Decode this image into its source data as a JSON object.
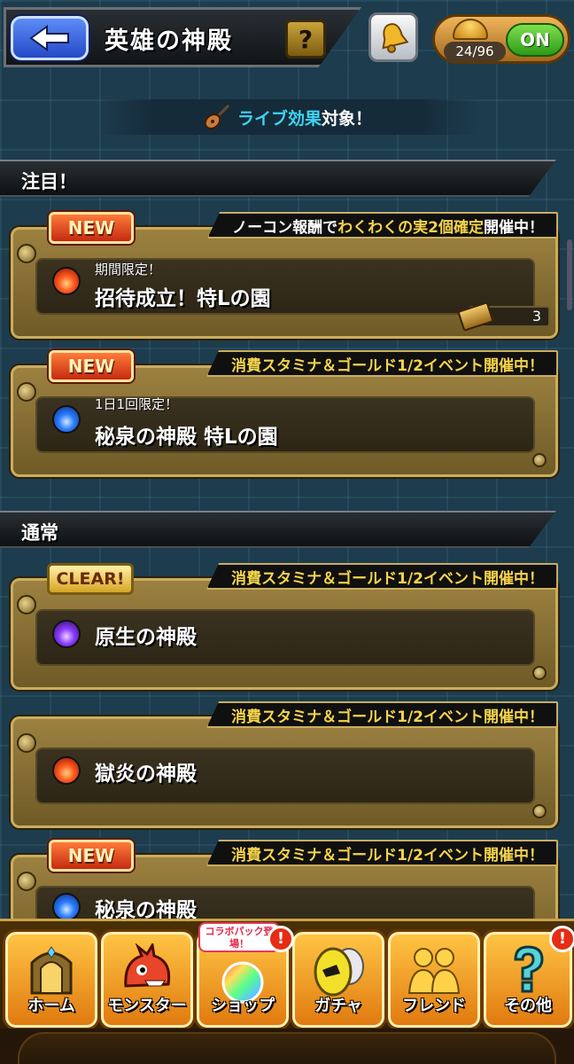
{
  "header": {
    "title": "英雄の神殿",
    "help_label": "?",
    "stamina_count": "24/96",
    "toggle_label": "ON"
  },
  "live_banner": {
    "accent": "ライブ効果",
    "rest": "対象！"
  },
  "sections": [
    {
      "title": "注目！"
    },
    {
      "title": "通常"
    }
  ],
  "cards": [
    {
      "badge": "NEW",
      "event_parts": [
        "ノーコン報酬で",
        "わくわくの実2個確定",
        "開催中！"
      ],
      "element": "fire",
      "sub": "期間限定！",
      "name": "招待成立！特Lの園",
      "ticket_count": "3"
    },
    {
      "badge": "NEW",
      "event_parts": [
        "消費スタミナ＆ゴールド1/2イベント開催中！"
      ],
      "element": "water",
      "sub": "1日1回限定！",
      "name": "秘泉の神殿 特Lの園"
    },
    {
      "badge": "CLEAR!",
      "event_parts": [
        "消費スタミナ＆ゴールド1/2イベント開催中！"
      ],
      "element": "dark",
      "name": "原生の神殿"
    },
    {
      "badge": "",
      "event_parts": [
        "消費スタミナ＆ゴールド1/2イベント開催中！"
      ],
      "element": "fire",
      "name": "獄炎の神殿"
    },
    {
      "badge": "NEW",
      "event_parts": [
        "消費スタミナ＆ゴールド1/2イベント開催中！"
      ],
      "element": "water",
      "name": "秘泉の神殿"
    }
  ],
  "bottom_nav": {
    "collab_tag": "コラボパック登場！",
    "alert": "!",
    "items": [
      {
        "label": "ホーム"
      },
      {
        "label": "モンスター"
      },
      {
        "label": "ショップ"
      },
      {
        "label": "ガチャ"
      },
      {
        "label": "フレンド"
      },
      {
        "label": "その他"
      }
    ]
  }
}
